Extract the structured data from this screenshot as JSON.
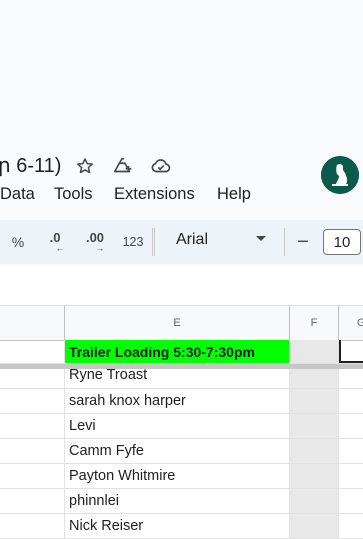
{
  "header": {
    "title": "ր 6-11)",
    "icons": [
      "star-icon",
      "move-to-drive-icon",
      "cloud-saved-icon"
    ],
    "avatar": "user-avatar"
  },
  "menu": [
    "Data",
    "Tools",
    "Extensions",
    "Help"
  ],
  "toolbar": {
    "percent": "%",
    "decrease_decimal": ".0",
    "increase_decimal": ".00",
    "number_format": "123",
    "font": "Arial",
    "font_size_minus": "−",
    "font_size": "10"
  },
  "columns": [
    "E",
    "F",
    "G"
  ],
  "rows": [
    "Trailer Loading 5:30-7:30pm",
    "Ryne Troast",
    "sarah knox harper",
    "Levi",
    "Camm Fyfe",
    "Payton Whitmire",
    "phinnlei",
    "Nick Reiser"
  ],
  "colors": {
    "header_cell_bg": "#00ff00",
    "avatar_bg": "#0c5a4b",
    "toolbar_bg": "#eef2f9"
  }
}
